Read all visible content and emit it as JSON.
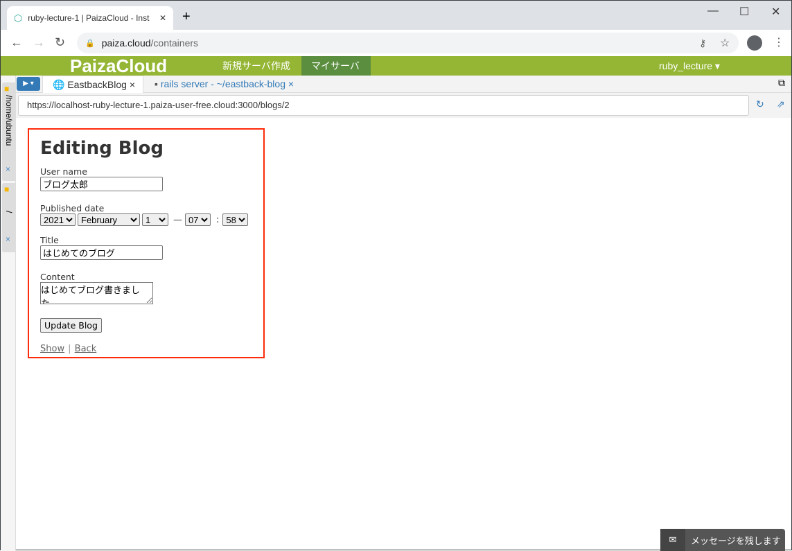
{
  "browser": {
    "tab_title": "ruby-lecture-1 | PaizaCloud - Inst",
    "address": "paiza.cloud/containers",
    "address_host": "paiza.cloud",
    "address_path": "/containers"
  },
  "header": {
    "logo": "PaizaCloud",
    "nav": [
      "新規サーバ作成",
      "マイサーバ"
    ],
    "user": "ruby_lecture"
  },
  "sidebar": {
    "items": [
      {
        "label": "/home/ubuntu",
        "close": "×"
      },
      {
        "label": "/",
        "close": "×"
      }
    ]
  },
  "ide": {
    "tabs": [
      {
        "label": "EastbackBlog ×",
        "active": true
      },
      {
        "label": "rails server - ~/eastback-blog ×",
        "active": false
      }
    ],
    "url": "https://localhost-ruby-lecture-1.paiza-user-free.cloud:3000/blogs/2"
  },
  "form": {
    "heading": "Editing Blog",
    "user_label": "User name",
    "user_value": "ブログ太郎",
    "date_label": "Published date",
    "year": "2021",
    "month": "February",
    "day": "1",
    "dash": "—",
    "hour": "07",
    "colon": ":",
    "minute": "58",
    "title_label": "Title",
    "title_value": "はじめてのブログ",
    "content_label": "Content",
    "content_value": "はじめてブログ書きました。",
    "submit": "Update Blog",
    "show": "Show",
    "sep": "|",
    "back": "Back"
  },
  "chat": {
    "label": "メッセージを残します"
  },
  "colors": {
    "brand_green": "#94b634",
    "active_nav": "#5b8f3f",
    "highlight": "#ff2a0a"
  }
}
